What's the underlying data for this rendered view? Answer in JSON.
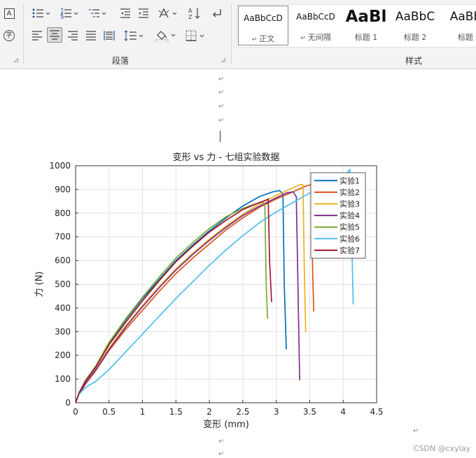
{
  "ribbon": {
    "paragraph_group_label": "段落",
    "styles_group_label": "样式",
    "left_icons": [
      "text-box-icon",
      "phonetic-guide-icon"
    ],
    "phonetic_char": "字",
    "text_box_char": "A",
    "sort_label": "A↓Z",
    "styles": [
      {
        "sample": "AaBbCcD",
        "name": "正文",
        "selected": true,
        "size": "small"
      },
      {
        "sample": "AaBbCcD",
        "name": "无间隔",
        "selected": false,
        "size": "small"
      },
      {
        "sample": "AaBl",
        "name": "标题 1",
        "selected": false,
        "size": "large"
      },
      {
        "sample": "AaBbC",
        "name": "标题 2",
        "selected": false,
        "size": "medium"
      },
      {
        "sample": "AaBb",
        "name": "标题",
        "selected": false,
        "size": "medium"
      }
    ]
  },
  "document": {
    "paragraph_mark": "↵",
    "watermark": "CSDN @cxylay"
  },
  "chart_data": {
    "type": "line",
    "title": "变形 vs 力 - 七组实验数据",
    "xlabel": "变形 (mm)",
    "ylabel": "力 (N)",
    "xlim": [
      0,
      4.5
    ],
    "ylim": [
      0,
      1000
    ],
    "xticks": [
      "0",
      "0.5",
      "1",
      "1.5",
      "2",
      "2.5",
      "3",
      "3.5",
      "4",
      "4.5"
    ],
    "yticks": [
      "0",
      "100",
      "200",
      "300",
      "400",
      "500",
      "600",
      "700",
      "800",
      "900",
      "1000"
    ],
    "grid": true,
    "legend_position": "top-right",
    "series": [
      {
        "name": "实验1",
        "color": "#0072BD",
        "x": [
          0,
          0.05,
          0.15,
          0.3,
          0.5,
          0.75,
          1.0,
          1.25,
          1.5,
          1.75,
          2.0,
          2.25,
          2.5,
          2.75,
          2.95,
          3.05,
          3.1,
          3.12,
          3.15
        ],
        "y": [
          0,
          40,
          90,
          150,
          250,
          350,
          440,
          520,
          600,
          665,
          725,
          780,
          830,
          870,
          890,
          895,
          880,
          500,
          225
        ]
      },
      {
        "name": "实验2",
        "color": "#D95319",
        "x": [
          0,
          0.05,
          0.15,
          0.3,
          0.5,
          0.75,
          1.0,
          1.25,
          1.5,
          1.75,
          2.0,
          2.25,
          2.5,
          2.75,
          3.0,
          3.25,
          3.45,
          3.52,
          3.54,
          3.56
        ],
        "y": [
          0,
          35,
          80,
          135,
          220,
          310,
          390,
          470,
          545,
          610,
          670,
          730,
          780,
          825,
          860,
          890,
          915,
          920,
          600,
          385
        ]
      },
      {
        "name": "实验3",
        "color": "#EDB120",
        "x": [
          0,
          0.05,
          0.15,
          0.3,
          0.5,
          0.75,
          1.0,
          1.25,
          1.5,
          1.75,
          2.0,
          2.25,
          2.5,
          2.75,
          3.0,
          3.2,
          3.35,
          3.4,
          3.42,
          3.44
        ],
        "y": [
          0,
          38,
          85,
          140,
          230,
          325,
          410,
          490,
          565,
          630,
          690,
          745,
          795,
          840,
          875,
          900,
          920,
          920,
          550,
          300
        ]
      },
      {
        "name": "实验4",
        "color": "#7E2F8E",
        "x": [
          0,
          0.05,
          0.15,
          0.3,
          0.5,
          0.75,
          1.0,
          1.25,
          1.5,
          1.75,
          2.0,
          2.25,
          2.5,
          2.75,
          3.0,
          3.15,
          3.25,
          3.3,
          3.33,
          3.35
        ],
        "y": [
          0,
          36,
          82,
          138,
          225,
          320,
          405,
          485,
          560,
          625,
          685,
          740,
          790,
          830,
          865,
          885,
          890,
          870,
          400,
          95
        ]
      },
      {
        "name": "实验5",
        "color": "#77AC30",
        "x": [
          0,
          0.05,
          0.15,
          0.3,
          0.5,
          0.75,
          1.0,
          1.25,
          1.5,
          1.75,
          2.0,
          2.25,
          2.5,
          2.7,
          2.8,
          2.83,
          2.85,
          2.87
        ],
        "y": [
          0,
          42,
          95,
          155,
          255,
          355,
          445,
          530,
          610,
          675,
          735,
          785,
          820,
          840,
          845,
          830,
          500,
          355
        ]
      },
      {
        "name": "实验6",
        "color": "#4DBEEE",
        "x": [
          0,
          0.05,
          0.15,
          0.3,
          0.5,
          0.75,
          1.0,
          1.25,
          1.5,
          1.75,
          2.0,
          2.25,
          2.5,
          2.75,
          3.0,
          3.25,
          3.5,
          3.75,
          4.0,
          4.1,
          4.12,
          4.15
        ],
        "y": [
          0,
          35,
          65,
          90,
          140,
          215,
          290,
          365,
          440,
          510,
          580,
          645,
          705,
          760,
          805,
          845,
          885,
          920,
          950,
          985,
          800,
          415
        ]
      },
      {
        "name": "实验7",
        "color": "#A2142F",
        "x": [
          0,
          0.05,
          0.15,
          0.3,
          0.5,
          0.75,
          1.0,
          1.25,
          1.5,
          1.75,
          2.0,
          2.25,
          2.5,
          2.75,
          2.85,
          2.88,
          2.9,
          2.93
        ],
        "y": [
          0,
          40,
          92,
          150,
          245,
          340,
          430,
          515,
          595,
          660,
          720,
          770,
          815,
          845,
          855,
          860,
          600,
          425
        ]
      }
    ]
  }
}
